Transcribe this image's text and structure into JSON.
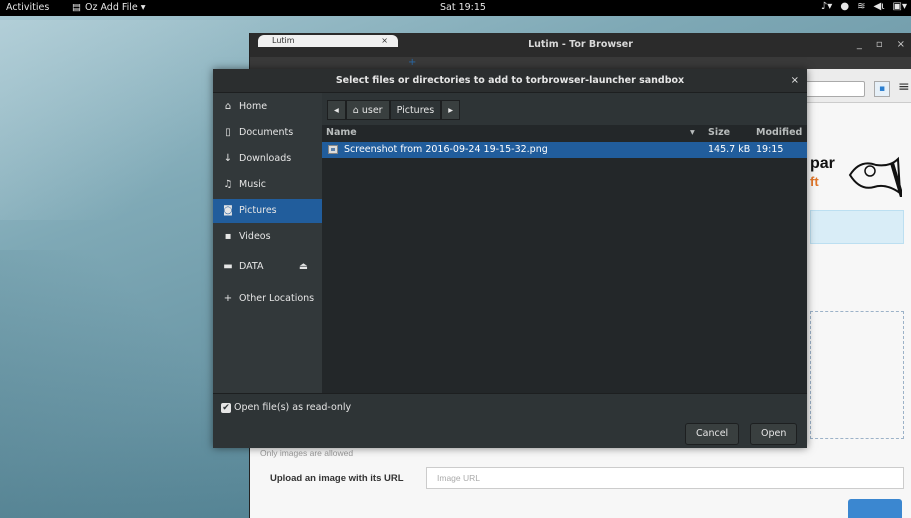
{
  "topbar": {
    "activities": "Activities",
    "app_menu": "Oz Add File ▾",
    "clock": "Sat 19:15"
  },
  "browser": {
    "title": "Lutim - Tor Browser",
    "tab_label": "Lutim",
    "brand_line1": "par",
    "brand_line2": "ft",
    "only_images": "Only images are allowed",
    "upload_label": "Upload an image with its URL",
    "url_placeholder": "Image URL"
  },
  "dialog": {
    "title": "Select files or directories to add to torbrowser-launcher sandbox",
    "close": "×",
    "sidebar": [
      {
        "label": "Home",
        "icon": "home-icon"
      },
      {
        "label": "Documents",
        "icon": "document-icon"
      },
      {
        "label": "Downloads",
        "icon": "download-icon"
      },
      {
        "label": "Music",
        "icon": "music-icon"
      },
      {
        "label": "Pictures",
        "icon": "camera-icon"
      },
      {
        "label": "Videos",
        "icon": "video-icon"
      },
      {
        "label": "DATA",
        "icon": "drive-icon"
      },
      {
        "label": "Other Locations",
        "icon": "plus-icon"
      }
    ],
    "pathbar": {
      "back": "◂",
      "user": "user",
      "current": "Pictures",
      "forward": "▸"
    },
    "columns": {
      "name": "Name",
      "size": "Size",
      "modified": "Modified"
    },
    "files": [
      {
        "name": "Screenshot from 2016-09-24 19-15-32.png",
        "size": "145.7 kB",
        "modified": "19:15"
      }
    ],
    "readonly_label": "Open file(s) as read-only",
    "cancel": "Cancel",
    "open": "Open"
  },
  "colors": {
    "selection": "#215d9c",
    "dialog_bg": "#2e3436",
    "accent_orange": "#e0762a"
  }
}
